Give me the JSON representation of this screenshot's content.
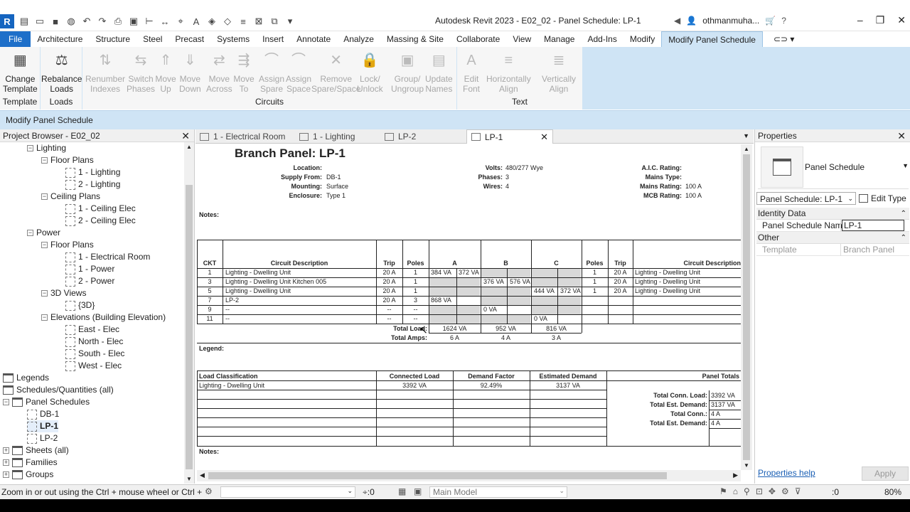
{
  "window": {
    "title": "Autodesk Revit 2023 - E02_02 - Panel Schedule: LP-1",
    "user": "othmanmuha...",
    "app_letter": "R"
  },
  "ribbon_tabs": [
    "File",
    "Architecture",
    "Structure",
    "Steel",
    "Precast",
    "Systems",
    "Insert",
    "Annotate",
    "Analyze",
    "Massing & Site",
    "Collaborate",
    "View",
    "Manage",
    "Add-Ins",
    "Modify",
    "Modify Panel Schedule"
  ],
  "ribbon": {
    "buttons": [
      {
        "l1": "Change",
        "l2": "Template",
        "enabled": true,
        "icon": "change-template-icon"
      },
      {
        "l1": "Rebalance",
        "l2": "Loads",
        "enabled": true,
        "icon": "rebalance-loads-icon"
      },
      {
        "l1": "Renumber",
        "l2": "Indexes",
        "enabled": false,
        "icon": "renumber-icon"
      },
      {
        "l1": "Switch",
        "l2": "Phases",
        "enabled": false,
        "icon": "switch-phases-icon"
      },
      {
        "l1": "Move",
        "l2": "Up",
        "enabled": false,
        "icon": "move-up-icon"
      },
      {
        "l1": "Move",
        "l2": "Down",
        "enabled": false,
        "icon": "move-down-icon"
      },
      {
        "l1": "Move",
        "l2": "Across",
        "enabled": false,
        "icon": "move-across-icon"
      },
      {
        "l1": "Move",
        "l2": "To",
        "enabled": false,
        "icon": "move-to-icon"
      },
      {
        "l1": "Assign",
        "l2": "Spare",
        "enabled": false,
        "icon": "assign-spare-icon"
      },
      {
        "l1": "Assign",
        "l2": "Space",
        "enabled": false,
        "icon": "assign-space-icon"
      },
      {
        "l1": "Remove",
        "l2": "Spare/Space",
        "enabled": false,
        "icon": "remove-spare-icon"
      },
      {
        "l1": "Lock/",
        "l2": "Unlock",
        "enabled": false,
        "icon": "lock-icon"
      },
      {
        "l1": "Group/",
        "l2": "Ungroup",
        "enabled": false,
        "icon": "group-icon"
      },
      {
        "l1": "Update",
        "l2": "Names",
        "enabled": false,
        "icon": "update-names-icon"
      },
      {
        "l1": "Edit",
        "l2": "Font",
        "enabled": false,
        "icon": "edit-font-icon"
      },
      {
        "l1": "Horizontally",
        "l2": "Align",
        "enabled": false,
        "icon": "horizontal-align-icon"
      },
      {
        "l1": "Vertically",
        "l2": "Align",
        "enabled": false,
        "icon": "vertical-align-icon"
      }
    ],
    "groups": [
      "Template",
      "Loads",
      "Circuits",
      "Text"
    ]
  },
  "context_bar": "Modify Panel Schedule",
  "project_browser": {
    "title": "Project Browser - E02_02",
    "items": [
      {
        "label": "Lighting",
        "level": 2,
        "toggle": "−",
        "kind": "folder"
      },
      {
        "label": "Floor Plans",
        "level": 3,
        "toggle": "−",
        "kind": "folder"
      },
      {
        "label": "1 - Lighting",
        "level": 4,
        "kind": "view"
      },
      {
        "label": "2 - Lighting",
        "level": 4,
        "kind": "view"
      },
      {
        "label": "Ceiling Plans",
        "level": 3,
        "toggle": "−",
        "kind": "folder"
      },
      {
        "label": "1 - Ceiling Elec",
        "level": 4,
        "kind": "view"
      },
      {
        "label": "2 - Ceiling Elec",
        "level": 4,
        "kind": "view"
      },
      {
        "label": "Power",
        "level": 2,
        "toggle": "−",
        "kind": "folder"
      },
      {
        "label": "Floor Plans",
        "level": 3,
        "toggle": "−",
        "kind": "folder"
      },
      {
        "label": "1 - Electrical Room",
        "level": 4,
        "kind": "view"
      },
      {
        "label": "1 - Power",
        "level": 4,
        "kind": "view"
      },
      {
        "label": "2 - Power",
        "level": 4,
        "kind": "view"
      },
      {
        "label": "3D Views",
        "level": 3,
        "toggle": "−",
        "kind": "folder"
      },
      {
        "label": "{3D}",
        "level": 4,
        "kind": "view"
      },
      {
        "label": "Elevations (Building Elevation)",
        "level": 3,
        "toggle": "−",
        "kind": "folder"
      },
      {
        "label": "East - Elec",
        "level": 4,
        "kind": "view"
      },
      {
        "label": "North - Elec",
        "level": 4,
        "kind": "view"
      },
      {
        "label": "South - Elec",
        "level": 4,
        "kind": "view"
      },
      {
        "label": "West - Elec",
        "level": 4,
        "kind": "view"
      },
      {
        "label": "Legends",
        "level": 1,
        "kind": "root"
      },
      {
        "label": "Schedules/Quantities (all)",
        "level": 1,
        "kind": "root"
      },
      {
        "label": "Panel Schedules",
        "level": 1,
        "toggle": "−",
        "kind": "root"
      },
      {
        "label": "DB-1",
        "level": 2,
        "kind": "view"
      },
      {
        "label": "LP-1",
        "level": 2,
        "kind": "view",
        "selected": true
      },
      {
        "label": "LP-2",
        "level": 2,
        "kind": "view"
      },
      {
        "label": "Sheets (all)",
        "level": 1,
        "toggle": "+",
        "kind": "root"
      },
      {
        "label": "Families",
        "level": 1,
        "toggle": "+",
        "kind": "root"
      },
      {
        "label": "Groups",
        "level": 1,
        "toggle": "+",
        "kind": "root"
      }
    ]
  },
  "doc_tabs": [
    {
      "label": "1 - Electrical Room"
    },
    {
      "label": "1 - Lighting"
    },
    {
      "label": "LP-2"
    },
    {
      "label": "LP-1",
      "active": true
    }
  ],
  "schedule": {
    "title": "Branch Panel: LP-1",
    "info_left": [
      {
        "k": "Location:",
        "v": ""
      },
      {
        "k": "Supply From:",
        "v": "DB-1"
      },
      {
        "k": "Mounting:",
        "v": "Surface"
      },
      {
        "k": "Enclosure:",
        "v": "Type 1"
      }
    ],
    "info_mid": [
      {
        "k": "Volts:",
        "v": "480/277 Wye"
      },
      {
        "k": "Phases:",
        "v": "3"
      },
      {
        "k": "Wires:",
        "v": "4"
      }
    ],
    "info_right": [
      {
        "k": "A.I.C. Rating:",
        "v": ""
      },
      {
        "k": "Mains Type:",
        "v": ""
      },
      {
        "k": "Mains Rating:",
        "v": "100 A"
      },
      {
        "k": "MCB Rating:",
        "v": "100 A"
      }
    ],
    "notes_label": "Notes:",
    "headers": {
      "ckt": "CKT",
      "desc": "Circuit Description",
      "trip": "Trip",
      "poles": "Poles",
      "a": "A",
      "b": "B",
      "c": "C",
      "poles_r": "Poles",
      "trip_r": "Trip",
      "desc_r": "Circuit Description"
    },
    "rows": [
      {
        "ckt": "1",
        "desc": "Lighting - Dwelling Unit",
        "trip": "20 A",
        "poles": "1",
        "a1": "384 VA",
        "a2": "372 VA",
        "b1": "",
        "b2": "",
        "c1": "",
        "c2": "",
        "poles_r": "1",
        "trip_r": "20 A",
        "desc_r": "Lighting - Dwelling Unit"
      },
      {
        "ckt": "3",
        "desc": "Lighting - Dwelling Unit Kitchen 005",
        "trip": "20 A",
        "poles": "1",
        "a1": "",
        "a2": "",
        "b1": "376 VA",
        "b2": "576 VA",
        "c1": "",
        "c2": "",
        "poles_r": "1",
        "trip_r": "20 A",
        "desc_r": "Lighting - Dwelling Unit"
      },
      {
        "ckt": "5",
        "desc": "Lighting - Dwelling Unit",
        "trip": "20 A",
        "poles": "1",
        "a1": "",
        "a2": "",
        "b1": "",
        "b2": "",
        "c1": "444 VA",
        "c2": "372 VA",
        "poles_r": "1",
        "trip_r": "20 A",
        "desc_r": "Lighting - Dwelling Unit"
      },
      {
        "ckt": "7",
        "desc": "LP-2",
        "trip": "20 A",
        "poles": "3",
        "a1": "868 VA",
        "a2": "",
        "b1": "",
        "b2": "",
        "c1": "",
        "c2": "",
        "poles_r": "",
        "trip_r": "",
        "desc_r": ""
      },
      {
        "ckt": "9",
        "desc": "--",
        "trip": "--",
        "poles": "--",
        "a1": "",
        "a2": "",
        "b1": "0 VA",
        "b2": "",
        "c1": "",
        "c2": "",
        "poles_r": "",
        "trip_r": "",
        "desc_r": ""
      },
      {
        "ckt": "11",
        "desc": "--",
        "trip": "--",
        "poles": "--",
        "a1": "",
        "a2": "",
        "b1": "",
        "b2": "",
        "c1": "0 VA",
        "c2": "",
        "poles_r": "",
        "trip_r": "",
        "desc_r": ""
      }
    ],
    "total_load_label": "Total Load:",
    "total_amps_label": "Total Amps:",
    "totals": {
      "a_load": "1624 VA",
      "b_load": "952 VA",
      "c_load": "816 VA",
      "a_amps": "6 A",
      "b_amps": "4 A",
      "c_amps": "3 A"
    },
    "legend_label": "Legend:",
    "load_headers": {
      "cls": "Load Classification",
      "conn": "Connected Load",
      "df": "Demand Factor",
      "est": "Estimated Demand",
      "pt": "Panel Totals"
    },
    "load_rows": [
      {
        "cls": "Lighting - Dwelling Unit",
        "conn": "3392 VA",
        "df": "92.49%",
        "est": "3137 VA"
      }
    ],
    "panel_totals": [
      {
        "k": "Total Conn. Load:",
        "v": "3392 VA"
      },
      {
        "k": "Total Est. Demand:",
        "v": "3137 VA"
      },
      {
        "k": "Total Conn.:",
        "v": "4 A"
      },
      {
        "k": "Total Est. Demand:",
        "v": "4 A"
      }
    ],
    "notes2_label": "Notes:"
  },
  "properties": {
    "title": "Properties",
    "type_name": "Panel Schedule",
    "selector": "Panel Schedule: LP-1",
    "edit_type": "Edit Type",
    "sections": [
      {
        "name": "Identity Data",
        "rows": [
          {
            "k": "Panel Schedule Name",
            "v": "LP-1",
            "editable": true
          }
        ]
      },
      {
        "name": "Other",
        "rows": [
          {
            "k": "Template",
            "v": "Branch Panel",
            "editable": false
          }
        ]
      }
    ],
    "help": "Properties help",
    "apply": "Apply"
  },
  "status": {
    "hint": "Zoom in or out using the Ctrl + mouse wheel or Ctrl + [+",
    "sel_count": ":0",
    "model": "Main Model",
    "filter_count": ":0",
    "zoom": "80%"
  },
  "colors": {
    "accent": "#1e6fc9",
    "ribbon": "#cfe4f5",
    "grey_cell": "#d8d8d8"
  }
}
